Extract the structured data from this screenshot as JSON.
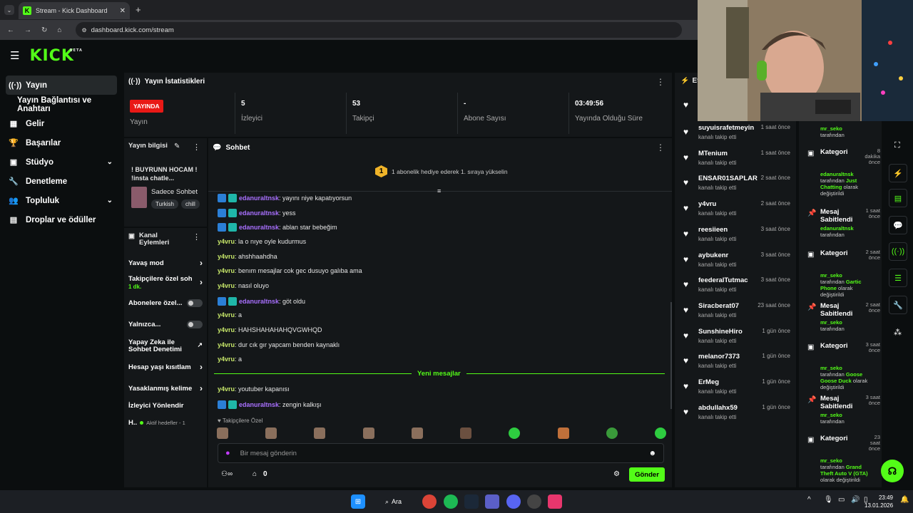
{
  "browser": {
    "tab_title": "Stream - Kick Dashboard",
    "url": "dashboard.kick.com/stream"
  },
  "header": {
    "logo": "KICK",
    "logo_sup": "BETA"
  },
  "nav": {
    "items": [
      {
        "label": "Yayın",
        "icon": "broadcast-icon"
      },
      {
        "label": "Yayın Bağlantısı ve Anahtarı",
        "icon": ""
      },
      {
        "label": "Gelir",
        "icon": "income-icon"
      },
      {
        "label": "Başarılar",
        "icon": "trophy-icon"
      },
      {
        "label": "Stüdyo",
        "icon": "studio-icon"
      },
      {
        "label": "Denetleme",
        "icon": "wrench-icon"
      },
      {
        "label": "Topluluk",
        "icon": "community-icon"
      },
      {
        "label": "Droplar ve ödüller",
        "icon": "drops-icon"
      }
    ]
  },
  "stats": {
    "title": "Yayın İstatistikleri",
    "live_badge": "YAYINDA",
    "items": [
      {
        "value": "",
        "label": "Yayın"
      },
      {
        "value": "5",
        "label": "İzleyici"
      },
      {
        "value": "53",
        "label": "Takipçi"
      },
      {
        "value": "-",
        "label": "Abone Sayısı"
      },
      {
        "value": "03:49:56",
        "label": "Yayında Olduğu Süre"
      }
    ]
  },
  "info": {
    "title": "Yayın bilgisi",
    "stream_title": "! BUYRUNN HOCAM ! !insta chatle...",
    "category": "Sadece Sohbet",
    "tags": [
      "Turkish",
      "chill"
    ]
  },
  "actions": {
    "title": "Kanal Eylemleri",
    "items": [
      {
        "label": "Yavaş mod",
        "sub": ""
      },
      {
        "label": "Takipçilere özel soh",
        "sub": "1 dk."
      },
      {
        "label": "Abonelere özel...",
        "sub": ""
      },
      {
        "label": "Yalnızca...",
        "sub": ""
      },
      {
        "label": "Yapay Zeka ile Sohbet Denetimi",
        "sub": ""
      },
      {
        "label": "Hesap yaşı kısıtlam",
        "sub": ""
      },
      {
        "label": "Yasaklanmış kelime",
        "sub": ""
      },
      {
        "label": "İzleyici Yönlendir",
        "sub": ""
      },
      {
        "label": "H..",
        "sub": "Aktif hedefler - 1"
      }
    ]
  },
  "chat": {
    "title": "Sohbet",
    "gift_banner": "1 abonelik hediye ederek 1. sıraya yükselin",
    "gift_rank": "1",
    "messages": [
      {
        "user": "edanuraltnsk",
        "text": ": yayını niye kapatıyorsun",
        "badges": true
      },
      {
        "user": "edanuraltnsk",
        "text": ": yess",
        "badges": true
      },
      {
        "user": "edanuraltnsk",
        "text": ": ablan star bebeğim",
        "badges": true
      },
      {
        "user": "y4vru",
        "text": ": la o nıye oyle kudurmus",
        "badges": false
      },
      {
        "user": "y4vru",
        "text": ": ahshhaahdha",
        "badges": false
      },
      {
        "user": "y4vru",
        "text": ": benım mesajlar cok gec dusuyo galıba ama",
        "badges": false
      },
      {
        "user": "y4vru",
        "text": ": nasıl oluyo",
        "badges": false
      },
      {
        "user": "edanuraltnsk",
        "text": ": göt oldu",
        "badges": true
      },
      {
        "user": "y4vru",
        "text": ": a",
        "badges": false
      },
      {
        "user": "y4vru",
        "text": ": HAHSHAHAHAHQVGWHQD",
        "badges": false
      },
      {
        "user": "y4vru",
        "text": ": dur cık gır yapcam benden kaynaklı",
        "badges": false
      },
      {
        "user": "y4vru",
        "text": ": a",
        "badges": false
      },
      {
        "user": "y4vru",
        "text": ": youtuber kapanısı",
        "badges": false
      },
      {
        "user": "edanuraltnsk",
        "text": ": zengin kalkışı",
        "badges": true
      }
    ],
    "new_messages": "Yeni mesajlar",
    "emote_section": "Takipçilere Özel",
    "input_placeholder": "Bir mesaj gönderin",
    "points": "0",
    "send": "Gönder"
  },
  "follows": {
    "title": "Etkinlikler",
    "items": [
      {
        "name": "suyuisrafetmeyin",
        "sub": "kanalı takip etti",
        "time": "1 saat önce"
      },
      {
        "name": "MTenium",
        "sub": "kanalı takip etti",
        "time": "1 saat önce"
      },
      {
        "name": "ENSAR01SAPLAR",
        "sub": "kanalı takip etti",
        "time": "2 saat önce"
      },
      {
        "name": "y4vru",
        "sub": "kanalı takip etti",
        "time": "2 saat önce"
      },
      {
        "name": "reesiieen",
        "sub": "kanalı takip etti",
        "time": "3 saat önce"
      },
      {
        "name": "aybukenr",
        "sub": "kanalı takip etti",
        "time": "3 saat önce"
      },
      {
        "name": "feederalTutmac",
        "sub": "kanalı takip etti",
        "time": "3 saat önce"
      },
      {
        "name": "Siracberat07",
        "sub": "kanalı takip etti",
        "time": "23 saat önce"
      },
      {
        "name": "SunshineHiro",
        "sub": "kanalı takip etti",
        "time": "1 gün önce"
      },
      {
        "name": "melanor7373",
        "sub": "kanalı takip etti",
        "time": "1 gün önce"
      },
      {
        "name": "ErMeg",
        "sub": "kanalı takip etti",
        "time": "1 gün önce"
      },
      {
        "name": "abdullahx59",
        "sub": "kanalı takip etti",
        "time": "1 gün önce"
      }
    ]
  },
  "activity": {
    "top_user": "mr_seko",
    "top_suffix": "tarafından",
    "items": [
      {
        "title": "Kategori",
        "time": "8 dakika önce",
        "user": "edanuraltnsk",
        "mid": "tarafından",
        "value": "Just Chatting",
        "end": "olarak değiştirildi"
      },
      {
        "title": "Mesaj Sabitlendi",
        "time": "1 saat önce",
        "user": "edanuraltnsk",
        "mid": "tarafından",
        "value": "",
        "end": ""
      },
      {
        "title": "Kategori",
        "time": "2 saat önce",
        "user": "mr_seko",
        "mid": "tarafından",
        "value": "Gartic Phone",
        "end": "olarak değiştirildi"
      },
      {
        "title": "Mesaj Sabitlendi",
        "time": "2 saat önce",
        "user": "mr_seko",
        "mid": "tarafından",
        "value": "",
        "end": ""
      },
      {
        "title": "Kategori",
        "time": "3 saat önce",
        "user": "mr_seko",
        "mid": "tarafından",
        "value": "Goose Goose Duck",
        "end": "olarak değiştirildi"
      },
      {
        "title": "Mesaj Sabitlendi",
        "time": "3 saat önce",
        "user": "mr_seko",
        "mid": "tarafından",
        "value": "",
        "end": ""
      },
      {
        "title": "Kategori",
        "time": "23 saat önce",
        "user": "mr_seko",
        "mid": "tarafından",
        "value": "Grand Theft Auto V (GTA)",
        "end": "olarak değiştirildi"
      }
    ]
  },
  "taskbar": {
    "search": "Ara",
    "time": "23:49",
    "date": "13.01.2026"
  },
  "colors": {
    "accent": "#53fc18",
    "live": "#e91916",
    "panel": "#141719",
    "bg": "#0b0e0f"
  }
}
